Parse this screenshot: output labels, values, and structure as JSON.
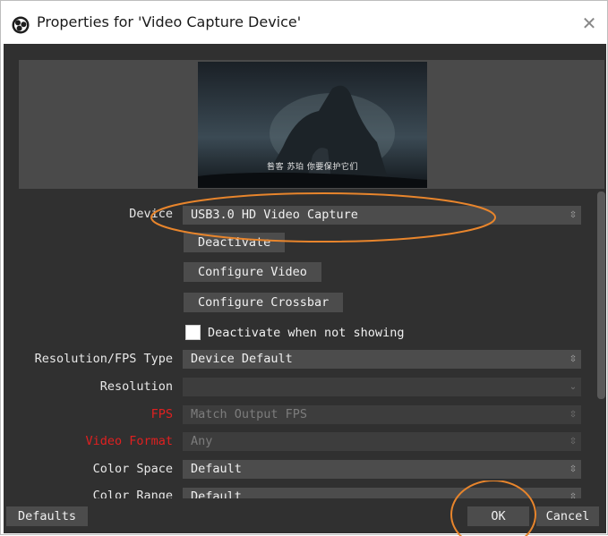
{
  "window": {
    "title": "Properties for 'Video Capture Device'",
    "close_icon": "close-icon"
  },
  "preview": {
    "subtitle": "咎客 苏珀 你要保护它们"
  },
  "form": {
    "device": {
      "label": "Device",
      "value": "USB3.0 HD Video Capture"
    },
    "buttons": {
      "deactivate": "Deactivate",
      "configure_video": "Configure Video",
      "configure_crossbar": "Configure Crossbar"
    },
    "deactivate_when_not_showing": {
      "label": "Deactivate when not showing",
      "checked": false
    },
    "resolution_fps_type": {
      "label": "Resolution/FPS Type",
      "value": "Device Default"
    },
    "resolution": {
      "label": "Resolution",
      "value": ""
    },
    "fps": {
      "label": "FPS",
      "value": "Match Output FPS"
    },
    "video_format": {
      "label": "Video Format",
      "value": "Any"
    },
    "color_space": {
      "label": "Color Space",
      "value": "Default"
    },
    "color_range": {
      "label": "Color Range",
      "value": "Default"
    }
  },
  "footer": {
    "defaults": "Defaults",
    "ok": "OK",
    "cancel": "Cancel"
  },
  "colors": {
    "background": "#303030",
    "field": "#4c4c4c",
    "error_label": "#e02020",
    "annotation": "#e8852c"
  }
}
